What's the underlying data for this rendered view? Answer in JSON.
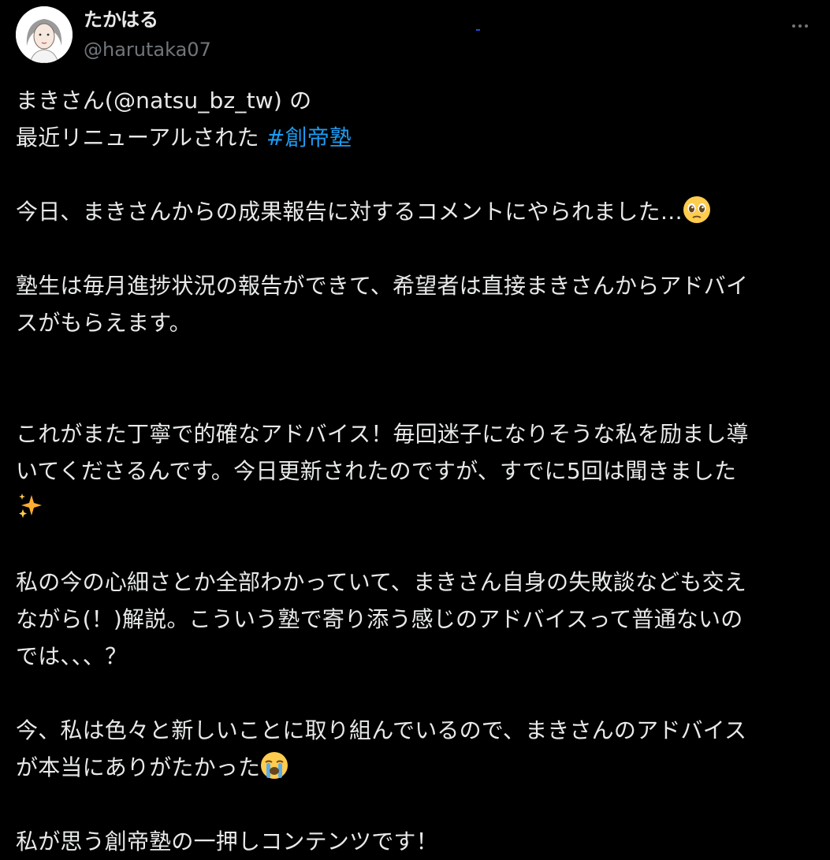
{
  "author": {
    "display_name": "たかはる",
    "handle": "@harutaka07",
    "avatar_icon": "person-avatar-icon"
  },
  "menu": {
    "more_icon": "more-dots-icon"
  },
  "tweet": {
    "line1_prefix": "まきさん(",
    "mention": "@natsu_bz_tw",
    "line1_suffix": ") の",
    "line2_text": "最近リニューアルされた",
    "hashtag": "#創帝塾",
    "p2": "今日、まきさんからの成果報告に対するコメントにやられました…",
    "p3_l1": "塾生は毎月進捗状況の報告ができて、希望者は直接まきさんからアドバイ",
    "p3_l2": "スがもらえます。",
    "p4_l1": "これがまた丁寧で的確なアドバイス！毎回迷子になりそうな私を励まし導",
    "p4_l2": "いてくださるんです。今日更新されたのですが、すでに5回は聞きました",
    "p5_l1": "私の今の心細さとか全部わかっていて、まきさん自身の失敗談なども交え",
    "p5_l2": "ながら(！)解説。こういう塾で寄り添う感じのアドバイスって普通ないの",
    "p5_l3": "では、、、？",
    "p6_l1": "今、私は色々と新しいことに取り組んでいるので、まきさんのアドバイス",
    "p6_l2": "が本当にありがたかった",
    "p7": "私が思う創帝塾の一押しコンテンツです！",
    "emoji_1": "pleading-face-emoji",
    "emoji_2": "sparkles-emoji",
    "emoji_3": "loudly-crying-face-emoji"
  },
  "colors": {
    "background": "#000000",
    "text": "#e7e9ea",
    "secondary": "#71767b",
    "hashtag": "#1d9bf0"
  }
}
